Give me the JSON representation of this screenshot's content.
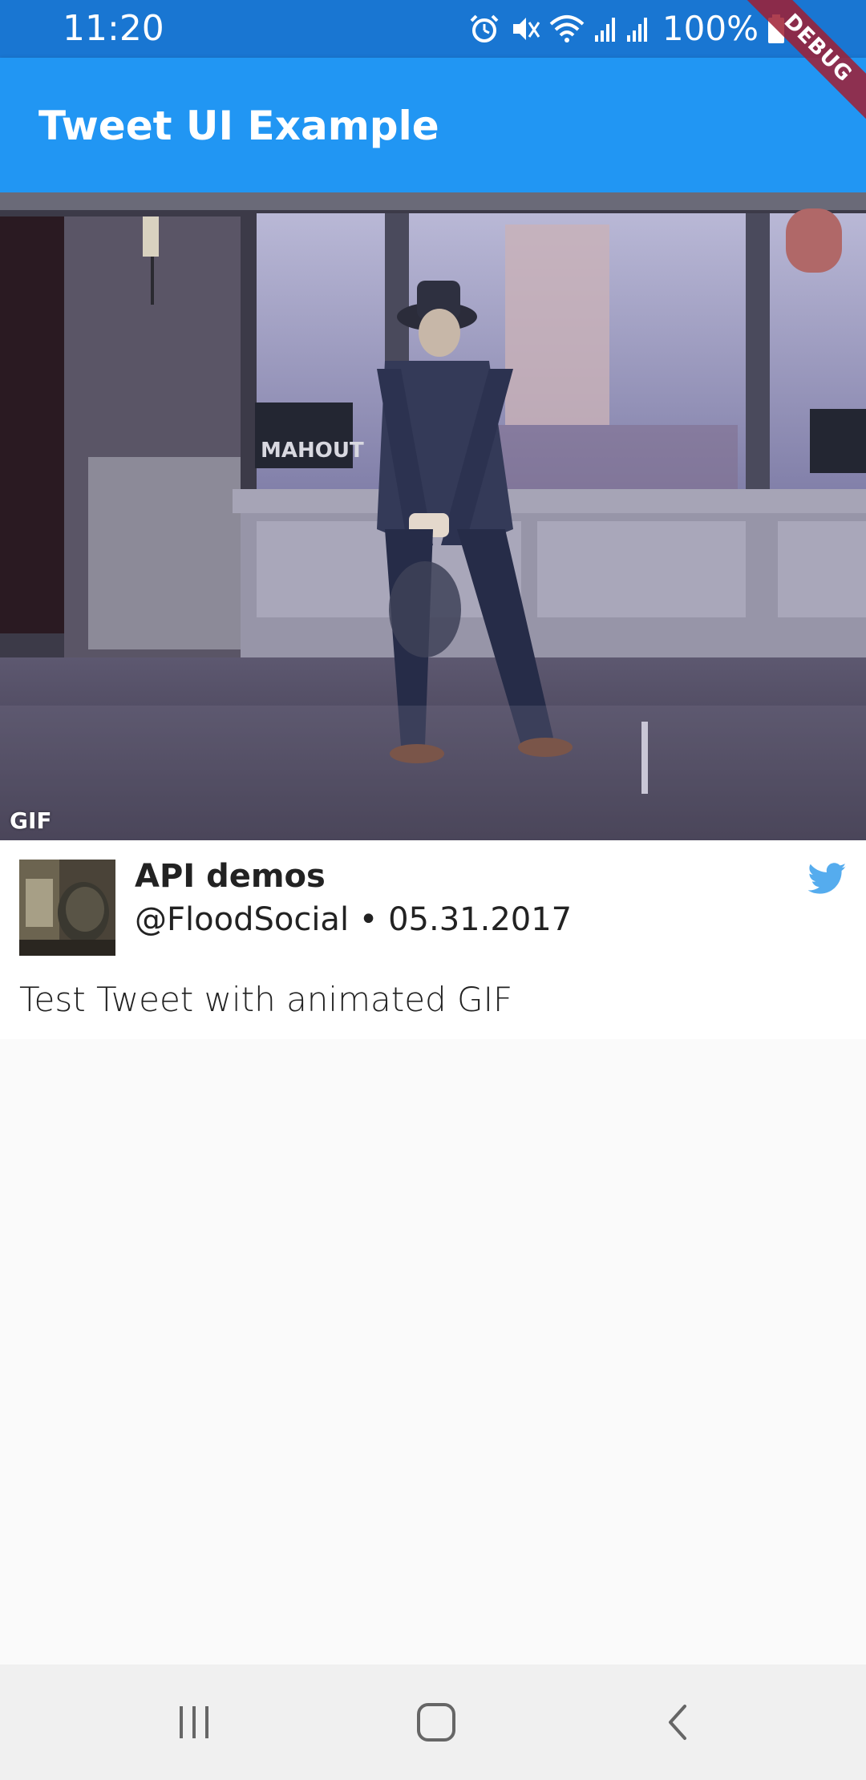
{
  "status_bar": {
    "time": "11:20",
    "battery_text": "100%",
    "icons": [
      "alarm-icon",
      "vibrate-mute-icon",
      "wifi-icon",
      "signal-icon",
      "signal-icon",
      "battery-icon"
    ]
  },
  "debug_banner": "DEBUG",
  "app_bar": {
    "title": "Tweet UI Example",
    "color": "#2196f3"
  },
  "media": {
    "badge": "GIF",
    "sign_text": "MAHOUT"
  },
  "tweet": {
    "author_name": "API demos",
    "handle": "@FloodSocial",
    "separator": " • ",
    "date": "05.31.2017",
    "text": "Test Tweet with animated GIF",
    "brand_icon": "twitter-bird-icon",
    "brand_color": "#55acee"
  },
  "nav_bar": {
    "buttons": [
      "recents-icon",
      "home-icon",
      "back-icon"
    ]
  }
}
